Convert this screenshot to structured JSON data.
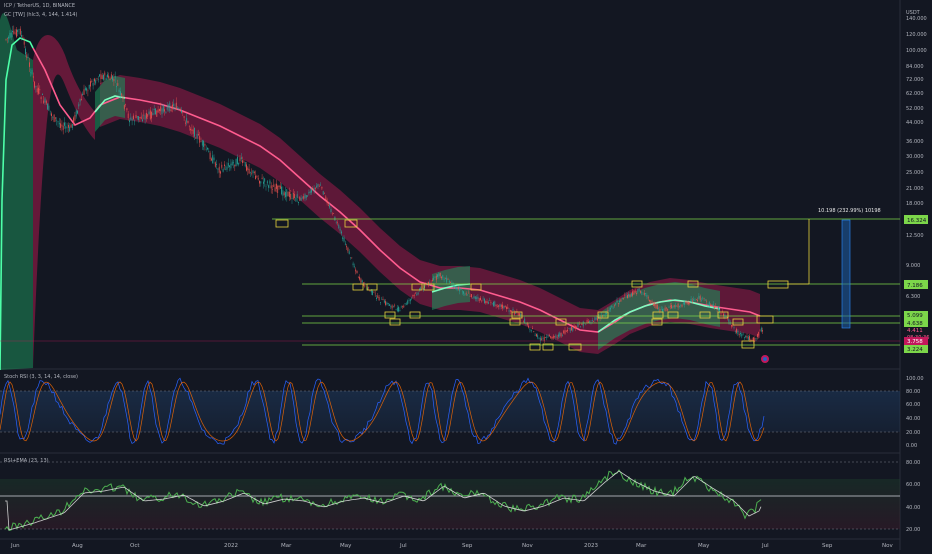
{
  "header": {
    "symbol_line": "ICP / TetherUS, 1D, BINANCE",
    "indicator_line": "GC [TW] (hlc3, 4, 144, 1.414)"
  },
  "price_axis": {
    "unit": "USDT",
    "ticks": [
      "140.000",
      "120.000",
      "100.000",
      "84.000",
      "72.000",
      "62.000",
      "52.000",
      "44.000",
      "36.000",
      "30.000",
      "25.000",
      "21.000",
      "18.000",
      "12.500",
      "9.000",
      "6.300",
      "5.099",
      "4.638",
      "3.758",
      "2.500"
    ]
  },
  "price_labels": {
    "resistance": "16.324",
    "level_a": "7.186",
    "level_b": "5.099",
    "level_c": "4.638",
    "last_price": "4.411",
    "countdown": "08:30:36",
    "support": "3.758",
    "bottom": "3.224"
  },
  "measure_label": "10.198 (232.99%) 10198",
  "stoch_rsi": {
    "title": "Stoch RSI (3, 3, 14, 14, close)",
    "ticks": [
      "100.00",
      "80.00",
      "60.00",
      "40.00",
      "20.00",
      "0.00"
    ]
  },
  "rsi_ema": {
    "title": "RSI+EMA (23, 13)",
    "ticks": [
      "80.00",
      "60.00",
      "40.00",
      "20.00"
    ]
  },
  "time_axis": [
    "Jun",
    "Aug",
    "Oct",
    "2022",
    "Mar",
    "May",
    "Jul",
    "Sep",
    "Nov",
    "2023",
    "Mar",
    "May",
    "Jul",
    "Sep",
    "Nov"
  ],
  "colors": {
    "background": "#131722",
    "band_bear": "#c2185b",
    "band_bull": "#26a69a",
    "line_bear": "#ff4f8b",
    "line_bull": "#5dffb0",
    "level_line": "#7cd64a",
    "rsi_line": "#4caf50"
  },
  "chart_data": [
    {
      "type": "line",
      "title": "ICP / TetherUS, 1D, BINANCE",
      "ylabel": "USDT",
      "log_scale": true,
      "series": [
        {
          "name": "ICP/USDT",
          "x": [
            "2021-06",
            "2021-07",
            "2021-08",
            "2021-09",
            "2021-10",
            "2021-11",
            "2021-12",
            "2022-01",
            "2022-02",
            "2022-03",
            "2022-04",
            "2022-05",
            "2022-06",
            "2022-07",
            "2022-08",
            "2022-09",
            "2022-10",
            "2022-11",
            "2022-12",
            "2023-01",
            "2023-02",
            "2023-03",
            "2023-04",
            "2023-05",
            "2023-06"
          ],
          "values": [
            90,
            40,
            60,
            48,
            45,
            44,
            35,
            30,
            21,
            18,
            17,
            8,
            6,
            6,
            7,
            5.5,
            5,
            4,
            3.5,
            4.5,
            6,
            5.5,
            5.5,
            5,
            4.4
          ]
        }
      ],
      "levels": [
        16.324,
        7.186,
        5.099,
        4.638,
        3.758
      ],
      "ylim": [
        3.0,
        160
      ]
    },
    {
      "type": "line",
      "title": "Stoch RSI (3, 3, 14, 14, close)",
      "ylim": [
        0,
        100
      ],
      "bands": [
        20,
        80
      ]
    },
    {
      "type": "line",
      "title": "RSI+EMA (23, 13)",
      "ylim": [
        15,
        85
      ]
    }
  ]
}
